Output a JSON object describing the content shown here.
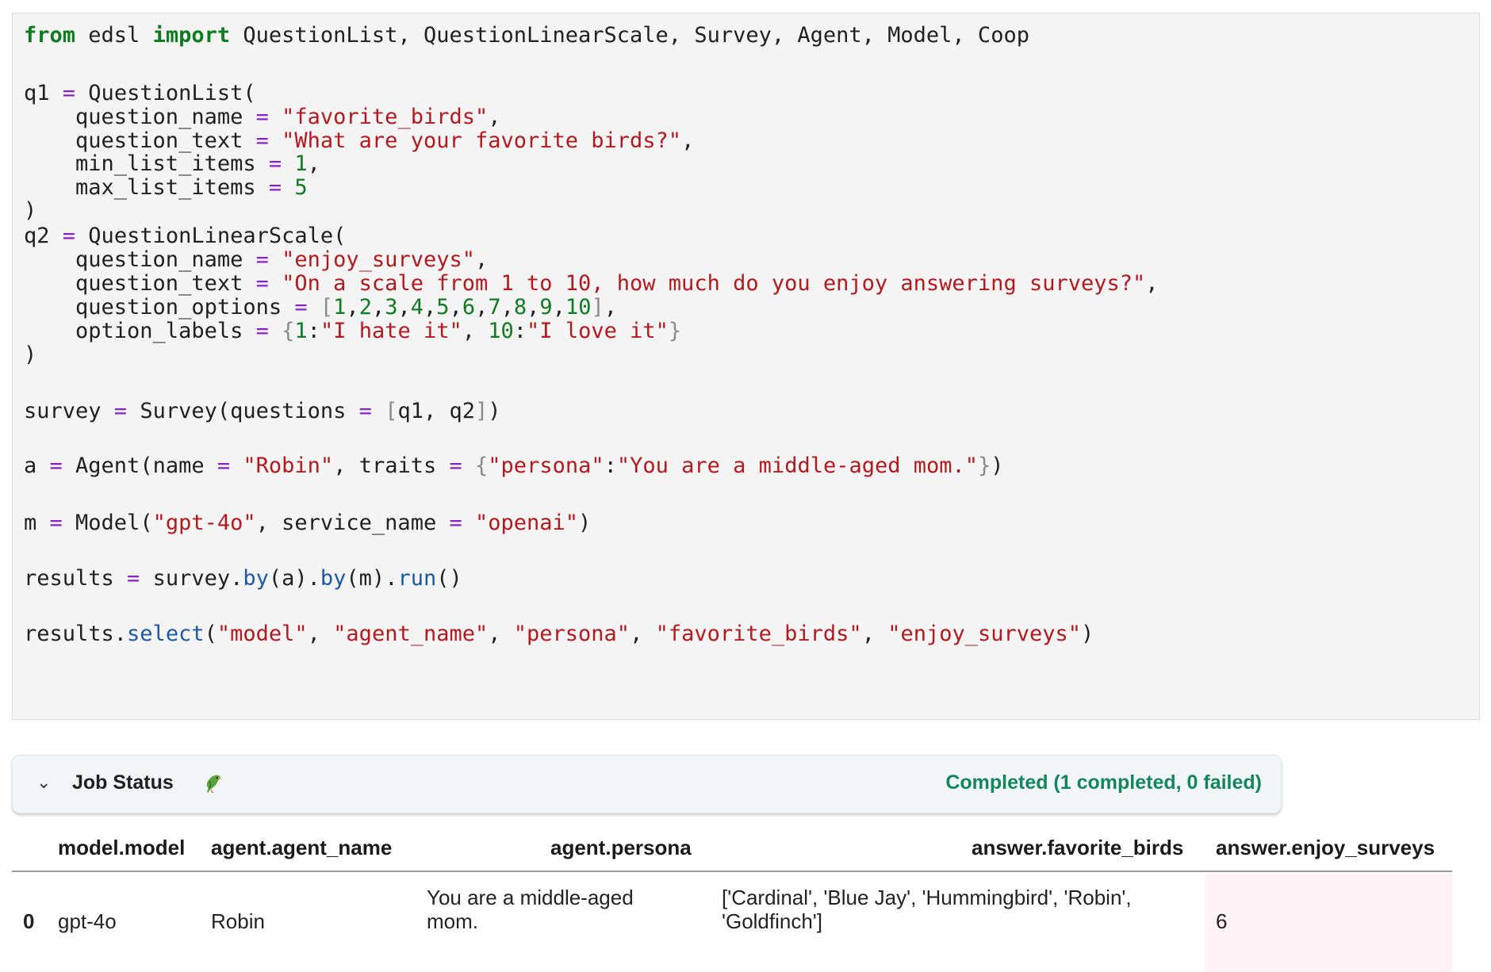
{
  "code_cell": {
    "lines": [
      [
        [
          "kw",
          "from"
        ],
        [
          "plain",
          " edsl "
        ],
        [
          "kw",
          "import"
        ],
        [
          "plain",
          " QuestionList, QuestionLinearScale, Survey, Agent, Model, Coop"
        ]
      ],
      [],
      [
        [
          "plain",
          "q1 "
        ],
        [
          "op",
          "="
        ],
        [
          "plain",
          " QuestionList("
        ]
      ],
      [
        [
          "plain",
          "    question_name "
        ],
        [
          "op",
          "="
        ],
        [
          "plain",
          " "
        ],
        [
          "str",
          "\"favorite_birds\""
        ],
        [
          "plain",
          ","
        ]
      ],
      [
        [
          "plain",
          "    question_text "
        ],
        [
          "op",
          "="
        ],
        [
          "plain",
          " "
        ],
        [
          "str",
          "\"What are your favorite birds?\""
        ],
        [
          "plain",
          ","
        ]
      ],
      [
        [
          "plain",
          "    min_list_items "
        ],
        [
          "op",
          "="
        ],
        [
          "plain",
          " "
        ],
        [
          "num",
          "1"
        ],
        [
          "plain",
          ","
        ]
      ],
      [
        [
          "plain",
          "    max_list_items "
        ],
        [
          "op",
          "="
        ],
        [
          "plain",
          " "
        ],
        [
          "num",
          "5"
        ]
      ],
      [
        [
          "plain",
          ")"
        ]
      ],
      [
        [
          "plain",
          "q2 "
        ],
        [
          "op",
          "="
        ],
        [
          "plain",
          " QuestionLinearScale("
        ]
      ],
      [
        [
          "plain",
          "    question_name "
        ],
        [
          "op",
          "="
        ],
        [
          "plain",
          " "
        ],
        [
          "str",
          "\"enjoy_surveys\""
        ],
        [
          "plain",
          ","
        ]
      ],
      [
        [
          "plain",
          "    question_text "
        ],
        [
          "op",
          "="
        ],
        [
          "plain",
          " "
        ],
        [
          "str",
          "\"On a scale from 1 to 10, how much do you enjoy answering surveys?\""
        ],
        [
          "plain",
          ","
        ]
      ],
      [
        [
          "plain",
          "    question_options "
        ],
        [
          "op",
          "="
        ],
        [
          "plain",
          " "
        ],
        [
          "br",
          "["
        ],
        [
          "num",
          "1"
        ],
        [
          "plain",
          ","
        ],
        [
          "num",
          "2"
        ],
        [
          "plain",
          ","
        ],
        [
          "num",
          "3"
        ],
        [
          "plain",
          ","
        ],
        [
          "num",
          "4"
        ],
        [
          "plain",
          ","
        ],
        [
          "num",
          "5"
        ],
        [
          "plain",
          ","
        ],
        [
          "num",
          "6"
        ],
        [
          "plain",
          ","
        ],
        [
          "num",
          "7"
        ],
        [
          "plain",
          ","
        ],
        [
          "num",
          "8"
        ],
        [
          "plain",
          ","
        ],
        [
          "num",
          "9"
        ],
        [
          "plain",
          ","
        ],
        [
          "num",
          "10"
        ],
        [
          "br",
          "]"
        ],
        [
          "plain",
          ","
        ]
      ],
      [
        [
          "plain",
          "    option_labels "
        ],
        [
          "op",
          "="
        ],
        [
          "plain",
          " "
        ],
        [
          "br",
          "{"
        ],
        [
          "num",
          "1"
        ],
        [
          "plain",
          ":"
        ],
        [
          "str",
          "\"I hate it\""
        ],
        [
          "plain",
          ", "
        ],
        [
          "num",
          "10"
        ],
        [
          "plain",
          ":"
        ],
        [
          "str",
          "\"I love it\""
        ],
        [
          "br",
          "}"
        ]
      ],
      [
        [
          "plain",
          ")"
        ]
      ],
      [],
      [
        [
          "plain",
          "survey "
        ],
        [
          "op",
          "="
        ],
        [
          "plain",
          " Survey(questions "
        ],
        [
          "op",
          "="
        ],
        [
          "plain",
          " "
        ],
        [
          "br",
          "["
        ],
        [
          "plain",
          "q1, q2"
        ],
        [
          "br",
          "]"
        ],
        [
          "plain",
          ")"
        ]
      ],
      [],
      [
        [
          "plain",
          "a "
        ],
        [
          "op",
          "="
        ],
        [
          "plain",
          " Agent(name "
        ],
        [
          "op",
          "="
        ],
        [
          "plain",
          " "
        ],
        [
          "str",
          "\"Robin\""
        ],
        [
          "plain",
          ", traits "
        ],
        [
          "op",
          "="
        ],
        [
          "plain",
          " "
        ],
        [
          "br",
          "{"
        ],
        [
          "str",
          "\"persona\""
        ],
        [
          "plain",
          ":"
        ],
        [
          "str",
          "\"You are a middle-aged mom.\""
        ],
        [
          "br",
          "}"
        ],
        [
          "plain",
          ")"
        ]
      ],
      [],
      [
        [
          "plain",
          "m "
        ],
        [
          "op",
          "="
        ],
        [
          "plain",
          " Model("
        ],
        [
          "str",
          "\"gpt-4o\""
        ],
        [
          "plain",
          ", service_name "
        ],
        [
          "op",
          "="
        ],
        [
          "plain",
          " "
        ],
        [
          "str",
          "\"openai\""
        ],
        [
          "plain",
          ")"
        ]
      ],
      [],
      [
        [
          "plain",
          "results "
        ],
        [
          "op",
          "="
        ],
        [
          "plain",
          " survey."
        ],
        [
          "fn",
          "by"
        ],
        [
          "plain",
          "(a)."
        ],
        [
          "fn",
          "by"
        ],
        [
          "plain",
          "(m)."
        ],
        [
          "fn",
          "run"
        ],
        [
          "plain",
          "()"
        ]
      ],
      [],
      [
        [
          "plain",
          "results."
        ],
        [
          "fn",
          "select"
        ],
        [
          "plain",
          "("
        ],
        [
          "str",
          "\"model\""
        ],
        [
          "plain",
          ", "
        ],
        [
          "str",
          "\"agent_name\""
        ],
        [
          "plain",
          ", "
        ],
        [
          "str",
          "\"persona\""
        ],
        [
          "plain",
          ", "
        ],
        [
          "str",
          "\"favorite_birds\""
        ],
        [
          "plain",
          ", "
        ],
        [
          "str",
          "\"enjoy_surveys\""
        ],
        [
          "plain",
          ")"
        ]
      ]
    ]
  },
  "job_status": {
    "toggle_icon": "chevron-down-icon",
    "title": "Job Status",
    "title_icon": "parrot-icon",
    "state": "Completed (1 completed, 0 failed)",
    "state_color": "#12875b"
  },
  "results_table": {
    "columns": [
      "model.model",
      "agent.agent_name",
      "agent.persona",
      "answer.favorite_birds",
      "answer.enjoy_surveys"
    ],
    "rows": [
      {
        "index": "0",
        "cells": [
          "gpt-4o",
          "Robin",
          "You are a middle-aged mom.",
          "['Cardinal', 'Blue Jay', 'Hummingbird', 'Robin', 'Goldfinch']",
          "6"
        ]
      }
    ],
    "highlight_color": "#fff2f6"
  }
}
